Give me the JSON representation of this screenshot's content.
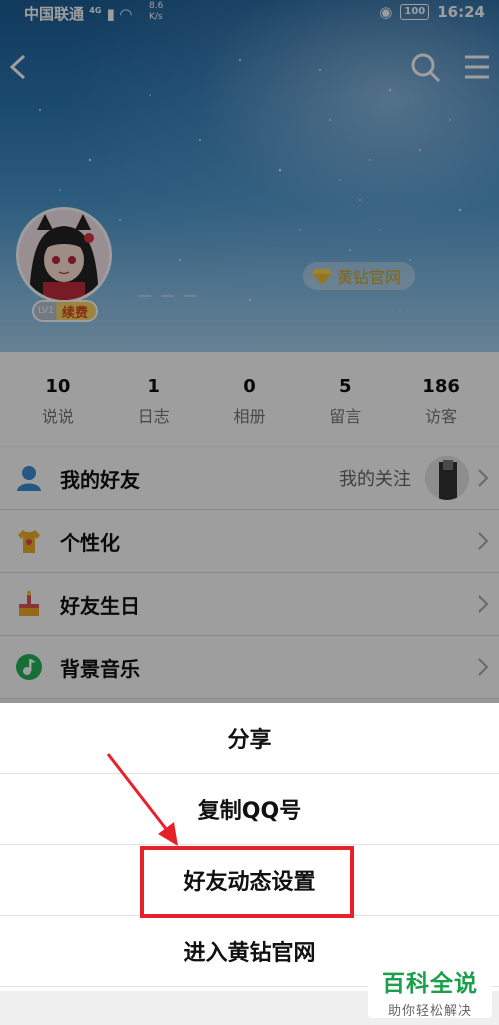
{
  "status_bar": {
    "carrier": "中国联通",
    "network": "4G",
    "speed_value": "8.6",
    "speed_unit": "K/s",
    "battery": "100",
    "time": "16:24"
  },
  "header": {
    "back_icon": "back-arrow-icon",
    "search_icon": "search-icon",
    "menu_icon": "hamburger-menu-icon"
  },
  "profile": {
    "level": "LV1",
    "renew_label": "续费",
    "nickname": "—  —  —",
    "vip_label": "黄钻官网"
  },
  "stats": [
    {
      "value": "10",
      "label": "说说"
    },
    {
      "value": "1",
      "label": "日志"
    },
    {
      "value": "0",
      "label": "相册"
    },
    {
      "value": "5",
      "label": "留言"
    },
    {
      "value": "186",
      "label": "访客"
    }
  ],
  "menu": [
    {
      "label": "我的好友",
      "right_text": "我的关注",
      "icon": "friends-icon"
    },
    {
      "label": "个性化",
      "right_text": "",
      "icon": "tshirt-icon"
    },
    {
      "label": "好友生日",
      "right_text": "",
      "icon": "cake-icon"
    },
    {
      "label": "背景音乐",
      "right_text": "",
      "icon": "music-icon"
    }
  ],
  "action_sheet": [
    {
      "label": "分享"
    },
    {
      "label": "复制QQ号"
    },
    {
      "label": "好友动态设置"
    },
    {
      "label": "进入黄钻官网"
    }
  ],
  "watermark": {
    "main": "百科全说",
    "sub": "助你轻松解决"
  },
  "colors": {
    "highlight": "#e8202a",
    "vip_gold": "#d4a521",
    "watermark_green": "#1aa04a"
  }
}
